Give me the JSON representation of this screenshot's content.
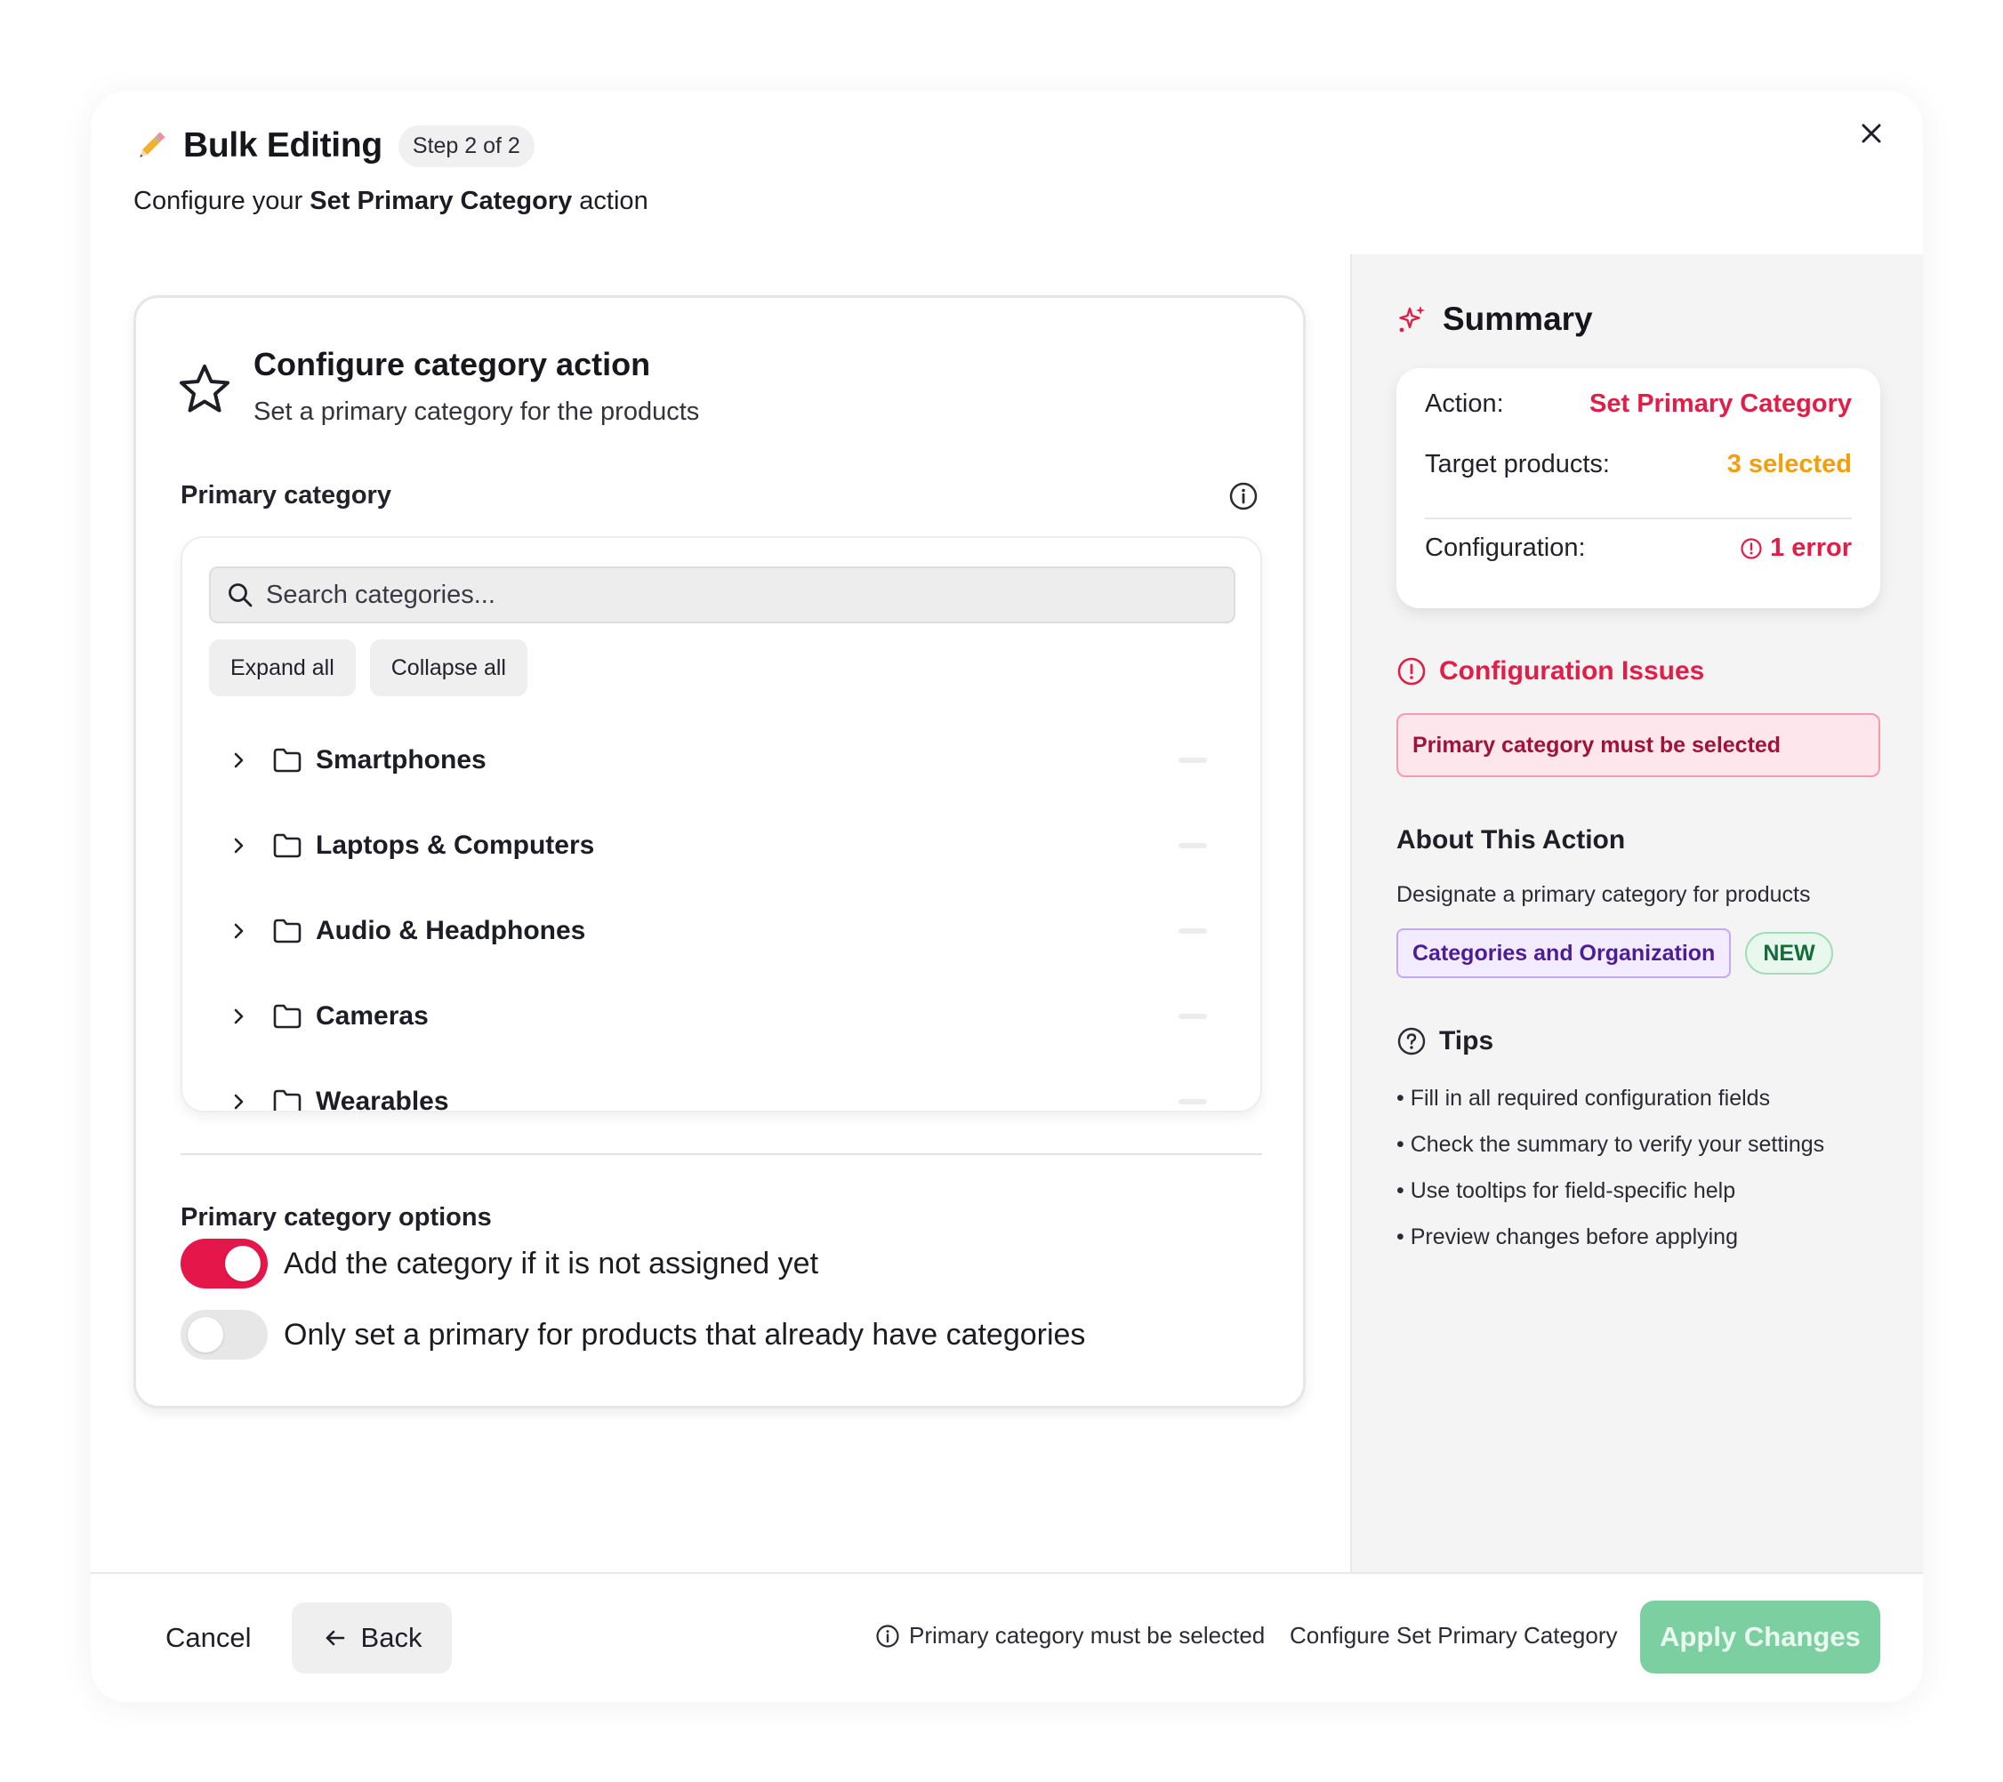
{
  "header": {
    "title": "Bulk Editing",
    "step_badge": "Step 2 of 2",
    "subtitle_prefix": "Configure your ",
    "subtitle_action": "Set Primary Category",
    "subtitle_suffix": " action"
  },
  "config_card": {
    "title": "Configure category action",
    "subtitle": "Set a primary category for the products",
    "field_label": "Primary category",
    "search_placeholder": "Search categories...",
    "expand_all": "Expand all",
    "collapse_all": "Collapse all",
    "categories": [
      {
        "label": "Smartphones"
      },
      {
        "label": "Laptops & Computers"
      },
      {
        "label": "Audio & Headphones"
      },
      {
        "label": "Cameras"
      },
      {
        "label": "Wearables"
      }
    ],
    "options_label": "Primary category options",
    "options": [
      {
        "label": "Add the category if it is not assigned yet",
        "enabled": true
      },
      {
        "label": "Only set a primary for products that already have categories",
        "enabled": false
      }
    ]
  },
  "summary": {
    "title": "Summary",
    "action_key": "Action:",
    "action_value": "Set Primary Category",
    "targets_key": "Target products:",
    "targets_value": "3 selected",
    "config_key": "Configuration:",
    "config_value": "1 error",
    "issues_title": "Configuration Issues",
    "issue_message": "Primary category must be selected",
    "about_title": "About This Action",
    "about_desc": "Designate a primary category for products",
    "tag_category": "Categories and Organization",
    "tag_new": "NEW",
    "tips_title": "Tips",
    "tips": [
      "Fill in all required configuration fields",
      "Check the summary to verify your settings",
      "Use tooltips for field-specific help",
      "Preview changes before applying"
    ]
  },
  "footer": {
    "cancel": "Cancel",
    "back": "Back",
    "validation_message": "Primary category must be selected",
    "configure_label": "Configure Set Primary Category",
    "apply": "Apply Changes"
  },
  "colors": {
    "accent": "#e11d48",
    "warning": "#f59e0b",
    "apply_disabled": "#7ccfa1"
  }
}
